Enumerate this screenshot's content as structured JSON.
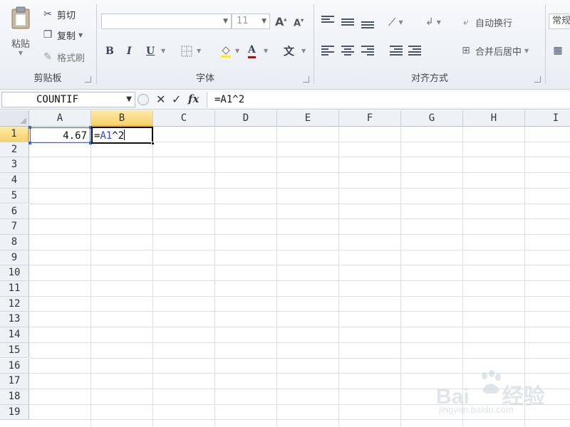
{
  "ribbon": {
    "clipboard": {
      "paste_label": "粘贴",
      "cut_label": "剪切",
      "copy_label": "复制",
      "format_painter_label": "格式刷",
      "group_label": "剪贴板"
    },
    "font": {
      "font_name": "",
      "font_size": "11",
      "bold": "B",
      "italic": "I",
      "underline": "U",
      "font_color_glyph": "A",
      "phonetic_glyph": "文",
      "group_label": "字体"
    },
    "alignment": {
      "wrap_text_label": "自动换行",
      "merge_center_label": "合并后居中",
      "group_label": "对齐方式"
    },
    "number": {
      "format_label": "常规"
    }
  },
  "formula_bar": {
    "name_box": "COUNTIF",
    "cancel_glyph": "✕",
    "enter_glyph": "✓",
    "fx_glyph": "fx",
    "formula": "=A1^2"
  },
  "grid": {
    "columns": [
      "A",
      "B",
      "C",
      "D",
      "E",
      "F",
      "G",
      "H",
      "I"
    ],
    "rows": [
      "1",
      "2",
      "3",
      "4",
      "5",
      "6",
      "7",
      "8",
      "9",
      "10",
      "11",
      "12",
      "13",
      "14",
      "15",
      "16",
      "17",
      "18",
      "19"
    ],
    "active_column": "B",
    "active_row": "1"
  },
  "cells": {
    "a1": "4.67",
    "b1_prefix": "=",
    "b1_ref": "A1",
    "b1_suffix": "^2"
  },
  "watermark": {
    "brand": "Bai",
    "brand_suffix": "经验",
    "url": "jingyan.baidu.com"
  },
  "colors": {
    "selection_border": "#111111",
    "reference_blue": "#3a63d4",
    "header_highlight": "#f7d26a"
  }
}
